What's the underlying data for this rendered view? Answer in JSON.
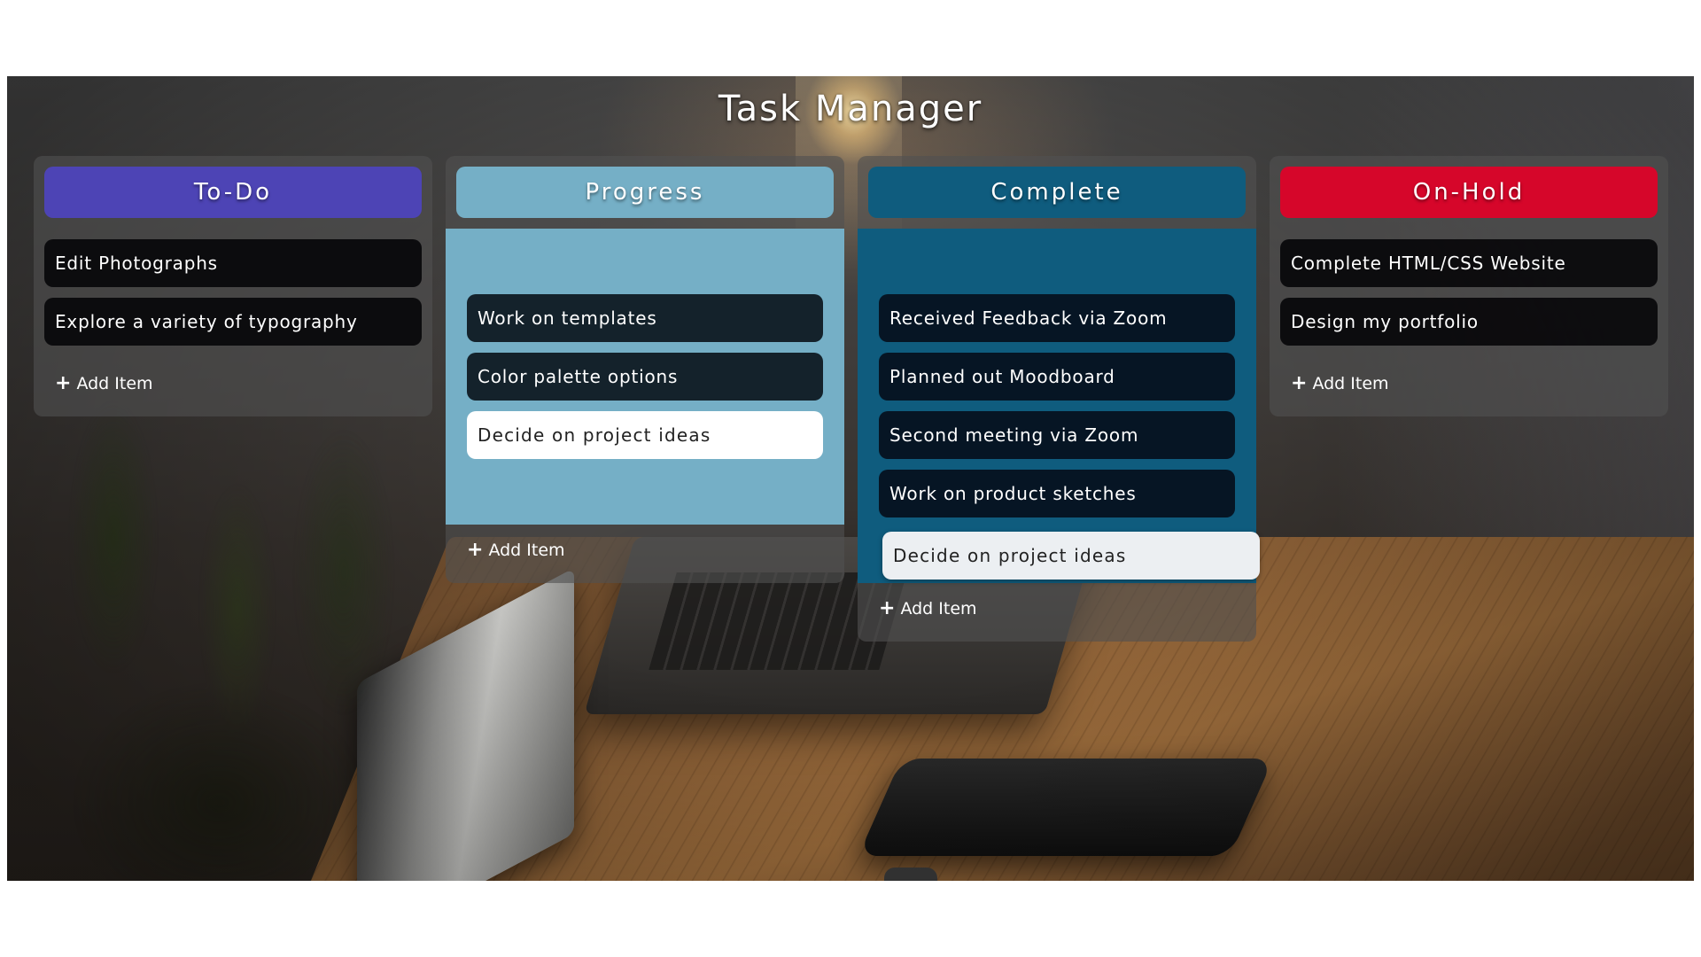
{
  "app": {
    "title": "Task Manager"
  },
  "colors": {
    "todo_header": "#4d44b5",
    "progress_header": "#75afc6",
    "complete_header": "#0f5c7e",
    "onhold_header": "#d6062a",
    "progress_dropzone": "#75afc6",
    "complete_dropzone": "#0f5c7e"
  },
  "columns": {
    "todo": {
      "name": "To-Do",
      "items": [
        "Edit Photographs",
        "Explore a variety of typography"
      ],
      "add_label": "Add Item"
    },
    "progress": {
      "name": "Progress",
      "items": [
        "Work on templates",
        "Color palette options"
      ],
      "editing_value": "Decide on project ideas",
      "add_label": "Add Item"
    },
    "complete": {
      "name": "Complete",
      "items": [
        "Received Feedback via Zoom",
        "Planned out Moodboard",
        "Second meeting via Zoom",
        "Work on product sketches"
      ],
      "editing_value": "Decide on project ideas",
      "add_label": "Add Item"
    },
    "onhold": {
      "name": "On-Hold",
      "items": [
        "Complete HTML/CSS Website",
        "Design my portfolio"
      ],
      "add_label": "Add Item"
    }
  },
  "icons": {
    "add": "plus-icon"
  }
}
